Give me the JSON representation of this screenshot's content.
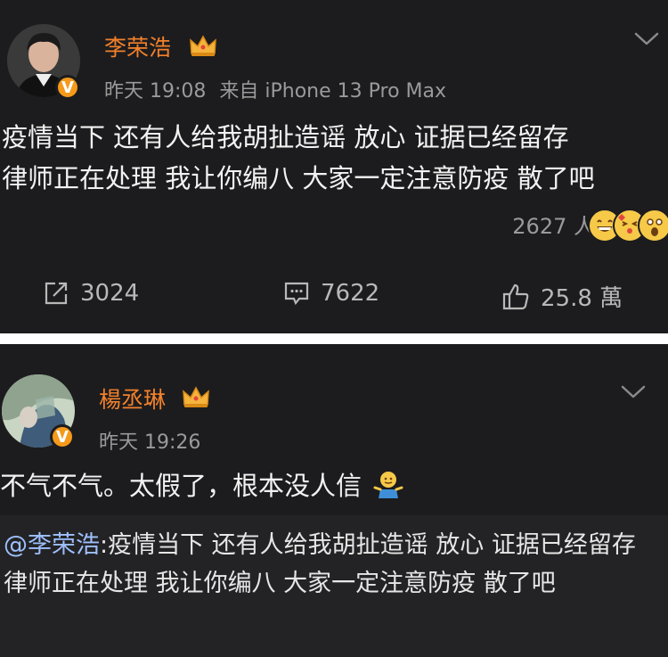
{
  "post1": {
    "username": "李荣浩",
    "time": "昨天 19:08",
    "source": "来自 iPhone 13 Pro Max",
    "text_line1": "疫情当下 还有人给我胡扯造谣 放心 证据已经留存",
    "text_line2": "律师正在处理 我让你编八 大家一定注意防疫 散了吧",
    "reactions_count": "2627 人",
    "repost_count": "3024",
    "comment_count": "7622",
    "like_count": "25.8 萬"
  },
  "post2": {
    "username": "楊丞琳",
    "time": "昨天 19:26",
    "text": "不气不气。太假了，根本没人信",
    "quote_user": "@李荣浩",
    "quote_text": ":疫情当下 还有人给我胡扯造谣 放心 证据已经留存 律师正在处理 我让你编八 大家一定注意防疫 散了吧"
  },
  "colors": {
    "background": "#000000",
    "card": "#1c1c1e",
    "username": "#f2812c",
    "verified_badge": "#f59a1a",
    "quote_link": "#9ec0ff"
  },
  "icons": [
    "crown-icon",
    "verified-badge-icon",
    "chevron-down-icon",
    "repost-icon",
    "comment-icon",
    "like-icon",
    "emoji-grin-icon",
    "emoji-kiss-icon",
    "emoji-shock-icon",
    "emoji-shrug-icon"
  ]
}
